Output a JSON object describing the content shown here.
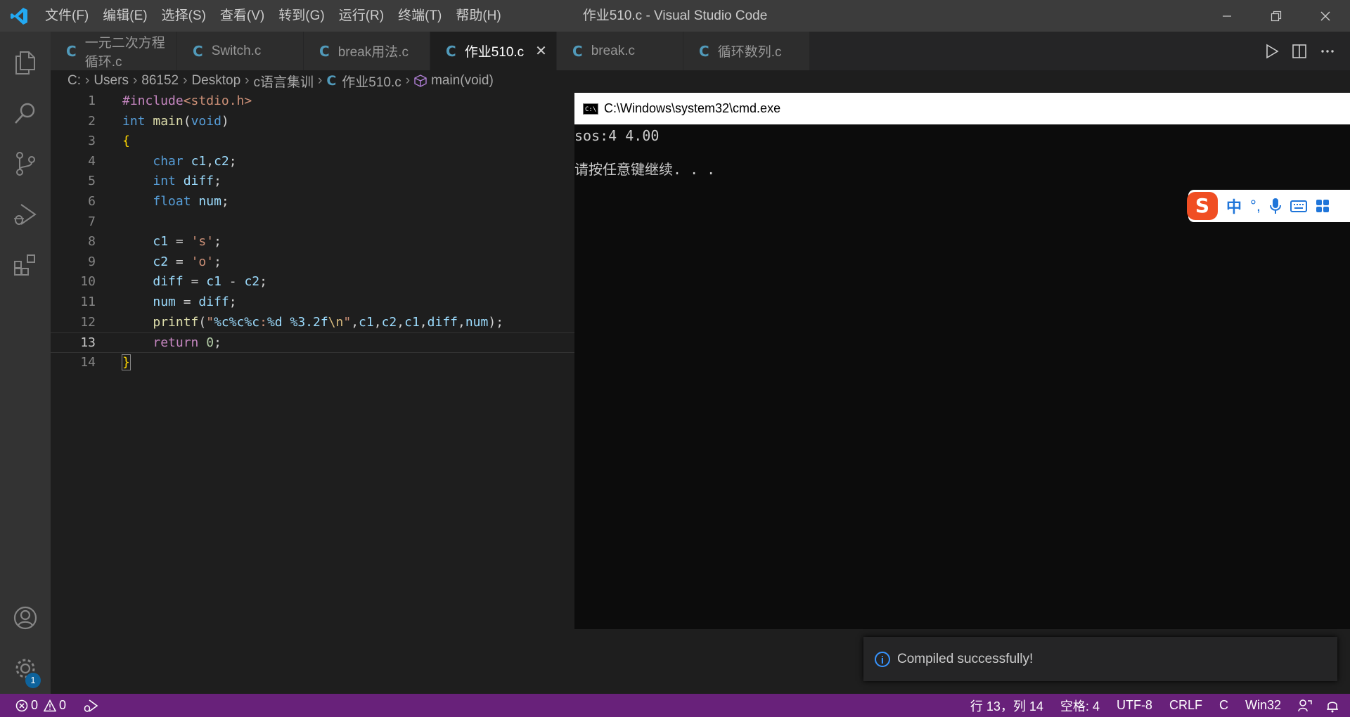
{
  "window": {
    "title": "作业510.c - Visual Studio Code",
    "menu": [
      "文件(F)",
      "编辑(E)",
      "选择(S)",
      "查看(V)",
      "转到(G)",
      "运行(R)",
      "终端(T)",
      "帮助(H)"
    ]
  },
  "activity_bar": {
    "items": [
      "explorer-icon",
      "search-icon",
      "source-control-icon",
      "run-debug-icon",
      "extensions-icon"
    ],
    "bottom": [
      "account-icon",
      "settings-gear-icon"
    ],
    "settings_badge": "1"
  },
  "tabs": [
    {
      "label": "一元二次方程循环.c",
      "active": false
    },
    {
      "label": "Switch.c",
      "active": false
    },
    {
      "label": "break用法.c",
      "active": false
    },
    {
      "label": "作业510.c",
      "active": true
    },
    {
      "label": "break.c",
      "active": false
    },
    {
      "label": "循环数列.c",
      "active": false
    }
  ],
  "tab_icon": "C",
  "breadcrumb": [
    "C:",
    "Users",
    "86152",
    "Desktop",
    "c语言集训",
    "作业510.c",
    "main(void)"
  ],
  "code": {
    "line_numbers": [
      "1",
      "2",
      "3",
      "4",
      "5",
      "6",
      "7",
      "8",
      "9",
      "10",
      "11",
      "12",
      "13",
      "14"
    ],
    "current_line": 13
  },
  "console": {
    "title": "C:\\Windows\\system32\\cmd.exe",
    "output_line1": "sos:4 4.00",
    "output_line2": "请按任意键继续. . ."
  },
  "ime": {
    "logo": "S",
    "mode": "中",
    "punct": "°,"
  },
  "notification": {
    "message": "Compiled successfully!"
  },
  "status_bar": {
    "errors": "0",
    "warnings": "0",
    "position": "行 13，列 14",
    "spaces": "空格: 4",
    "encoding": "UTF-8",
    "eol": "CRLF",
    "language": "C",
    "platform": "Win32"
  },
  "colors": {
    "status_bar": "#68217a",
    "accent": "#007acc",
    "c_icon": "#519aba"
  }
}
